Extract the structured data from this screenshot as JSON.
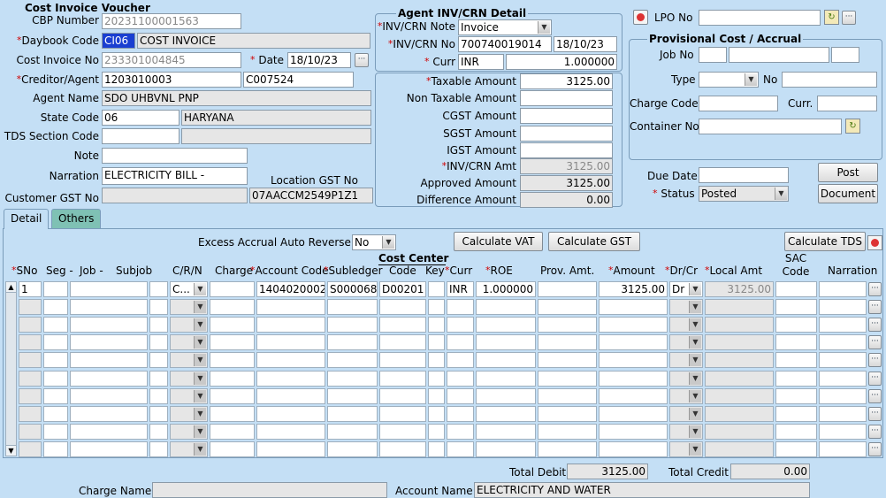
{
  "header": {
    "title": "Cost Invoice Voucher",
    "cbp_label": "CBP Number",
    "cbp_value": "20231100001563",
    "daybook_label": "Daybook Code",
    "daybook_code": "CI06",
    "daybook_name": "COST INVOICE",
    "cost_invoice_label": "Cost Invoice No",
    "cost_invoice_value": "233301004845",
    "date_label": "Date",
    "date_value": "18/10/23",
    "creditor_label": "Creditor/Agent",
    "creditor_code": "1203010003",
    "creditor_ref": "C007524",
    "agent_name_label": "Agent Name",
    "agent_name_value": "SDO UHBVNL PNP",
    "state_label": "State Code",
    "state_code": "06",
    "state_name": "HARYANA",
    "tds_label": "TDS Section Code",
    "tds_value": "",
    "tds_desc": "",
    "note_label": "Note",
    "note_value": "",
    "narration_label": "Narration",
    "narration_value": "ELECTRICITY BILL -",
    "location_gst_label": "Location GST No",
    "location_gst_value": "07AACCM2549P1Z1",
    "customer_gst_label": "Customer GST No",
    "customer_gst_value": ""
  },
  "agent_detail": {
    "title": "Agent INV/CRN Detail",
    "note_label": "INV/CRN Note",
    "note_value": "Invoice",
    "no_label": "INV/CRN No",
    "no_value": "700740019014",
    "no_date": "18/10/23",
    "curr_label": "Curr",
    "curr_value": "INR",
    "rate_value": "1.000000"
  },
  "amounts": {
    "taxable_label": "Taxable Amount",
    "taxable_value": "3125.00",
    "nontaxable_label": "Non Taxable Amount",
    "nontaxable_value": "",
    "cgst_label": "CGST Amount",
    "cgst_value": "",
    "sgst_label": "SGST Amount",
    "sgst_value": "",
    "igst_label": "IGST Amount",
    "igst_value": "",
    "invcrn_label": "INV/CRN Amt",
    "invcrn_value": "3125.00",
    "approved_label": "Approved Amount",
    "approved_value": "3125.00",
    "difference_label": "Difference Amount",
    "difference_value": "0.00"
  },
  "lpo": {
    "label": "LPO No",
    "value": ""
  },
  "provisional": {
    "title": "Provisional Cost / Accrual",
    "job_label": "Job No",
    "type_label": "Type",
    "no_label": "No",
    "charge_label": "Charge Code",
    "curr_label": "Curr.",
    "container_label": "Container No"
  },
  "due_date": {
    "label": "Due Date",
    "value": ""
  },
  "status": {
    "label": "Status",
    "value": "Posted"
  },
  "buttons": {
    "post": "Post",
    "document": "Document",
    "calc_vat": "Calculate VAT",
    "calc_gst": "Calculate GST",
    "calc_tds": "Calculate TDS"
  },
  "tabs": [
    "Detail",
    "Others"
  ],
  "grid": {
    "excess_label": "Excess Accrual Auto Reverse",
    "excess_value": "No",
    "cost_center_label": "Cost Center",
    "columns": {
      "sno": "SNo",
      "seg": "Seg -",
      "job": "Job -",
      "subjob": "Subjob",
      "crn": "C/R/N",
      "charge": "Charge",
      "account": "Account Code",
      "subledger": "Subledger",
      "code": "Code",
      "key": "Key",
      "curr": "Curr",
      "roe": "ROE",
      "prov": "Prov. Amt.",
      "amount": "Amount",
      "drcr": "Dr/Cr",
      "local": "Local  Amt",
      "sac": "SAC Code",
      "narration": "Narration"
    },
    "rows": [
      {
        "sno": "1",
        "crn": "C...",
        "account": "1404020002",
        "subledger": "S000068",
        "code": "D00201",
        "curr": "INR",
        "roe": "1.000000",
        "amount": "3125.00",
        "drcr": "Dr",
        "local": "3125.00"
      }
    ]
  },
  "footer": {
    "total_debit_label": "Total Debit",
    "total_debit": "3125.00",
    "total_credit_label": "Total Credit",
    "total_credit": "0.00",
    "charge_name_label": "Charge Name",
    "charge_name_value": "",
    "account_name_label": "Account Name",
    "account_name_value": "ELECTRICITY AND WATER"
  }
}
